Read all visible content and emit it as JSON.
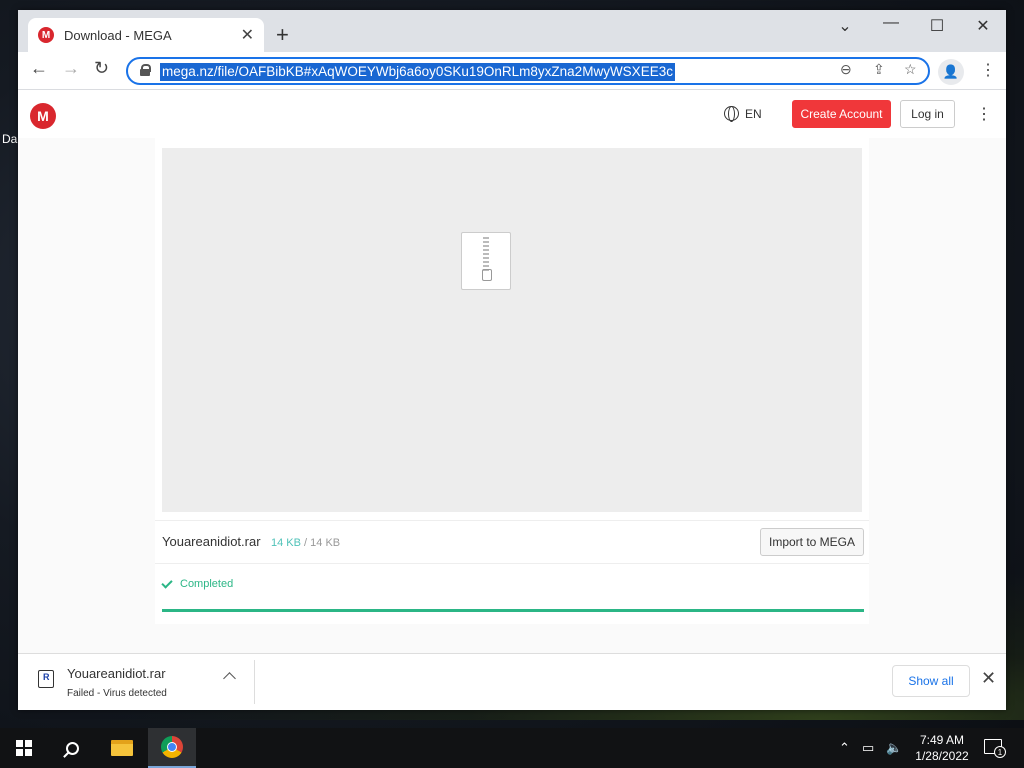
{
  "desktop": {
    "partial_label": "Da"
  },
  "browser": {
    "tab_title": "Download - MEGA",
    "favicon_letter": "M",
    "url": "mega.nz/file/OAFBibKB#xAqWOEYWbj6a6oy0SKu19OnRLm8yxZna2MwyWSXEE3c"
  },
  "mega": {
    "logo_letter": "M",
    "lang": "EN",
    "create_account": "Create Account",
    "login": "Log in",
    "file_name": "Youareanidiot.rar",
    "downloaded": "14 KB",
    "size_separator": "/",
    "total_size": "14 KB",
    "import_button": "Import to MEGA",
    "status_text": "Completed",
    "progress": 1.0,
    "accent": "#2bb686",
    "brand": "#d9272e"
  },
  "download_shelf": {
    "file_name": "Youareanidiot.rar",
    "status": "Failed - Virus detected",
    "show_all": "Show all"
  },
  "taskbar": {
    "time": "7:49 AM",
    "date": "1/28/2022",
    "notification_count": "1"
  }
}
